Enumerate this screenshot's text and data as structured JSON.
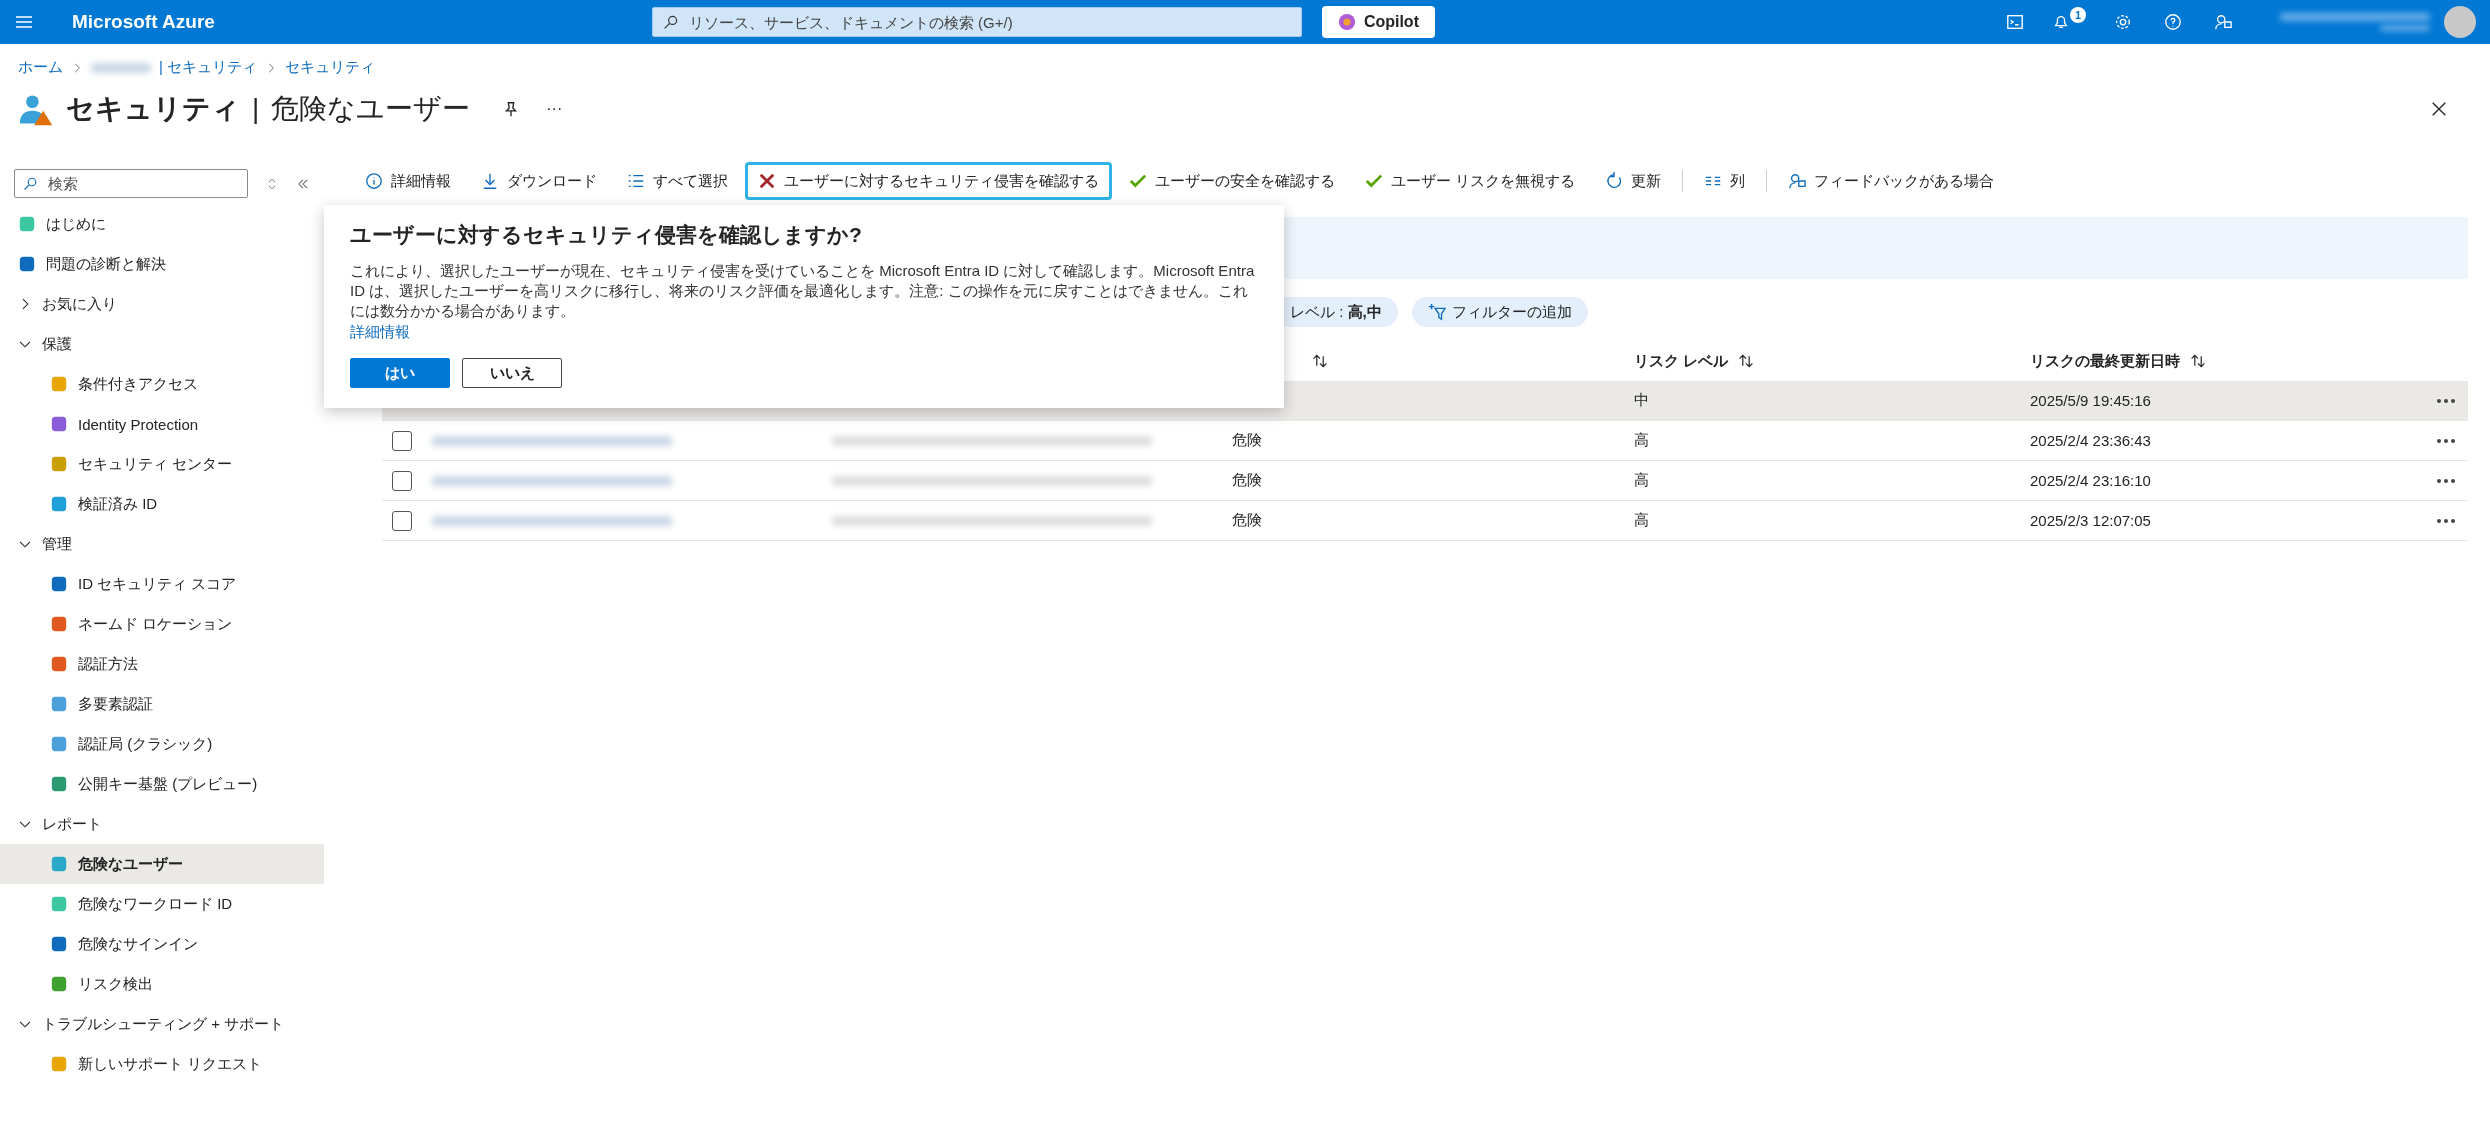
{
  "top_bar": {
    "brand": "Microsoft Azure",
    "search": {
      "placeholder": "リソース、サービス、ドキュメントの検索 (G+/)"
    },
    "copilot": "Copilot",
    "notification_count": "1"
  },
  "breadcrumb": [
    {
      "label": "ホーム"
    },
    {
      "label": "| セキュリティ"
    },
    {
      "label": "セキュリティ"
    }
  ],
  "page_title": {
    "service": "セキュリティ",
    "separator": "|",
    "page": "危険なユーザー",
    "more": "···"
  },
  "sidebar": {
    "search": {
      "placeholder": "検索"
    },
    "items": [
      {
        "label": "はじめに",
        "selected": false
      },
      {
        "label": "問題の診断と解決",
        "selected": false
      },
      {
        "label": "お気に入り",
        "expanded": false
      },
      {
        "label": "保護",
        "expanded": true,
        "children": [
          {
            "label": "条件付きアクセス",
            "selected": false
          },
          {
            "label": "Identity Protection",
            "selected": false
          },
          {
            "label": "セキュリティ センター",
            "selected": false
          },
          {
            "label": "検証済み ID",
            "selected": false
          }
        ]
      },
      {
        "label": "管理",
        "expanded": true,
        "children": [
          {
            "label": "ID セキュリティ スコア",
            "selected": false
          },
          {
            "label": "ネームド ロケーション",
            "selected": false
          },
          {
            "label": "認証方法",
            "selected": false
          },
          {
            "label": "多要素認証",
            "selected": false
          },
          {
            "label": "認証局 (クラシック)",
            "selected": false
          },
          {
            "label": "公開キー基盤 (プレビュー)",
            "selected": false
          }
        ]
      },
      {
        "label": "レポート",
        "expanded": true,
        "children": [
          {
            "label": "危険なユーザー",
            "selected": true
          },
          {
            "label": "危険なワークロード ID",
            "selected": false
          },
          {
            "label": "危険なサインイン",
            "selected": false
          },
          {
            "label": "リスク検出",
            "selected": false
          }
        ]
      },
      {
        "label": "トラブルシューティング + サポート",
        "expanded": true,
        "children": [
          {
            "label": "新しいサポート リクエスト",
            "selected": false
          }
        ]
      }
    ]
  },
  "toolbar": [
    {
      "label": "詳細情報",
      "focused": false
    },
    {
      "label": "ダウンロード",
      "focused": false
    },
    {
      "label": "すべて選択",
      "focused": false
    },
    {
      "label": "ユーザーに対するセキュリティ侵害を確認する",
      "focused": true
    },
    {
      "label": "ユーザーの安全を確認する",
      "focused": false
    },
    {
      "label": "ユーザー リスクを無視する",
      "focused": false
    },
    {
      "label": "更新",
      "focused": false
    },
    {
      "label": "列",
      "focused": false
    },
    {
      "label": "フィードバックがある場合",
      "focused": false
    }
  ],
  "confirm_popup": {
    "title": "ユーザーに対するセキュリティ侵害を確認しますか?",
    "message": "これにより、選択したユーザーが現在、セキュリティ侵害を受けていることを Microsoft Entra ID に対して確認します。Microsoft Entra ID は、選択したユーザーを高リスクに移行し、将来のリスク評価を最適化します。注意: この操作を元に戻すことはできません。これには数分かかる場合があります。",
    "link": "詳細情報",
    "buttons": [
      {
        "label": "はい",
        "primary": true
      },
      {
        "label": "いいえ",
        "primary": false
      }
    ]
  },
  "filters": [
    {
      "label": "レベル : **高,中**",
      "kind": "applied"
    },
    {
      "label": "フィルターの追加",
      "kind": "add"
    }
  ],
  "table": {
    "columns": [
      {
        "sortable": true
      },
      {
        "label": "リスク レベル",
        "sortable": true
      },
      {
        "label": "リスクの最終更新日時",
        "sortable": true
      }
    ],
    "rows": [
      {
        "risk_level": "中",
        "updated": "2025/5/9 19:45:16",
        "selected": true
      },
      {
        "risk_state": "危険",
        "risk_level": "高",
        "updated": "2025/2/4 23:36:43",
        "selected": false
      },
      {
        "risk_state": "危険",
        "risk_level": "高",
        "updated": "2025/2/4 23:16:10",
        "selected": false
      },
      {
        "risk_state": "危険",
        "risk_level": "高",
        "updated": "2025/2/3 12:07:05",
        "selected": false
      }
    ]
  }
}
